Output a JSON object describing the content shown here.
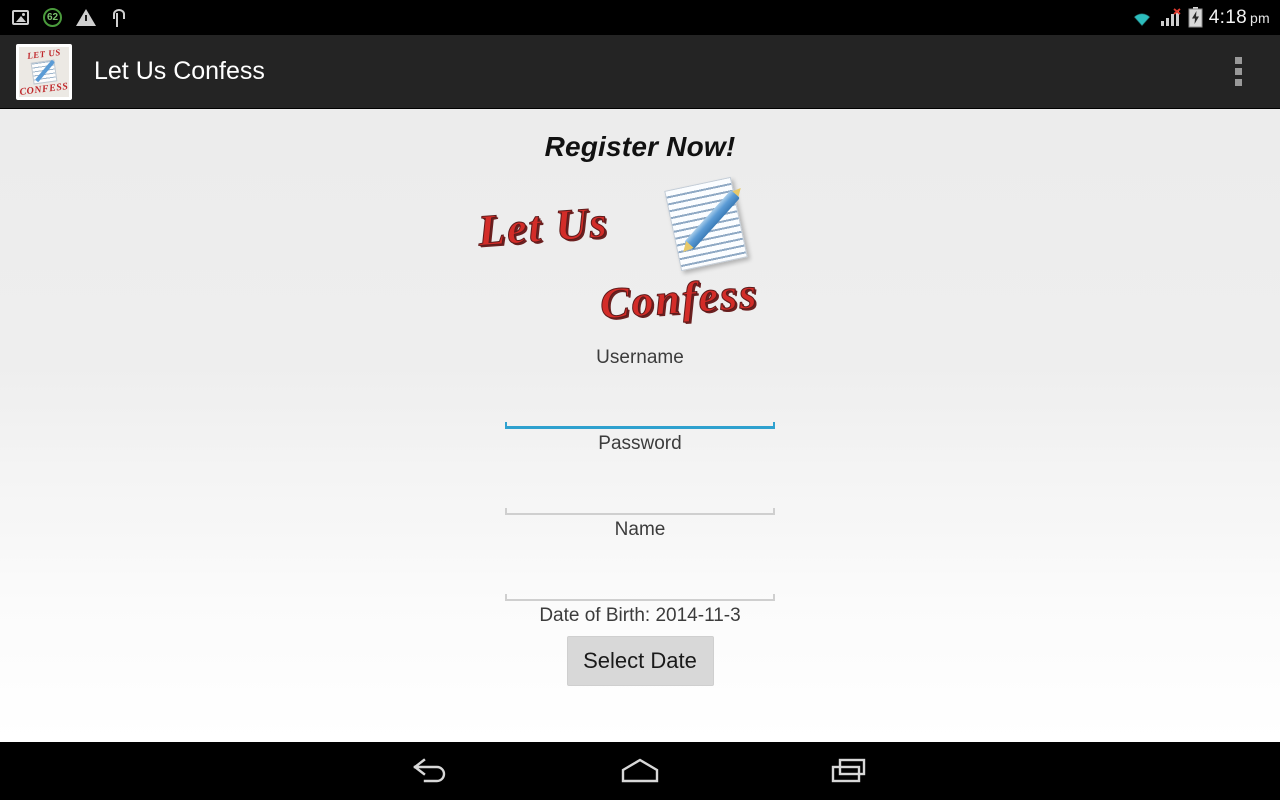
{
  "statusbar": {
    "icons": [
      "screenshot-icon",
      "battery-percent-icon",
      "warning-icon",
      "usb-icon",
      "wifi-icon",
      "signal-icon",
      "battery-charging-icon"
    ],
    "battery_percent": "62",
    "time": "4:18",
    "ampm": "pm"
  },
  "actionbar": {
    "app_icon": "let-us-confess-app-icon",
    "app_icon_text_top": "LET US",
    "app_icon_text_bottom": "CONFESS",
    "title": "Let Us Confess",
    "overflow": "overflow-menu-icon"
  },
  "content": {
    "heading": "Register Now!",
    "logo": {
      "line1": "Let Us",
      "line2": "Confess",
      "art": "notepad-and-pencil-illustration",
      "color": "#d32c28"
    },
    "fields": [
      {
        "label": "Username",
        "value": "",
        "placeholder": "",
        "focused": true
      },
      {
        "label": "Password",
        "value": "",
        "placeholder": "",
        "focused": false
      },
      {
        "label": "Name",
        "value": "",
        "placeholder": "",
        "focused": false
      }
    ],
    "dob_label": "Date of Birth: 2014-11-3",
    "date_button": "Select Date",
    "accent_color": "#2fa1cf"
  },
  "navbar": {
    "back": "back-icon",
    "home": "home-icon",
    "recents": "recents-icon"
  }
}
